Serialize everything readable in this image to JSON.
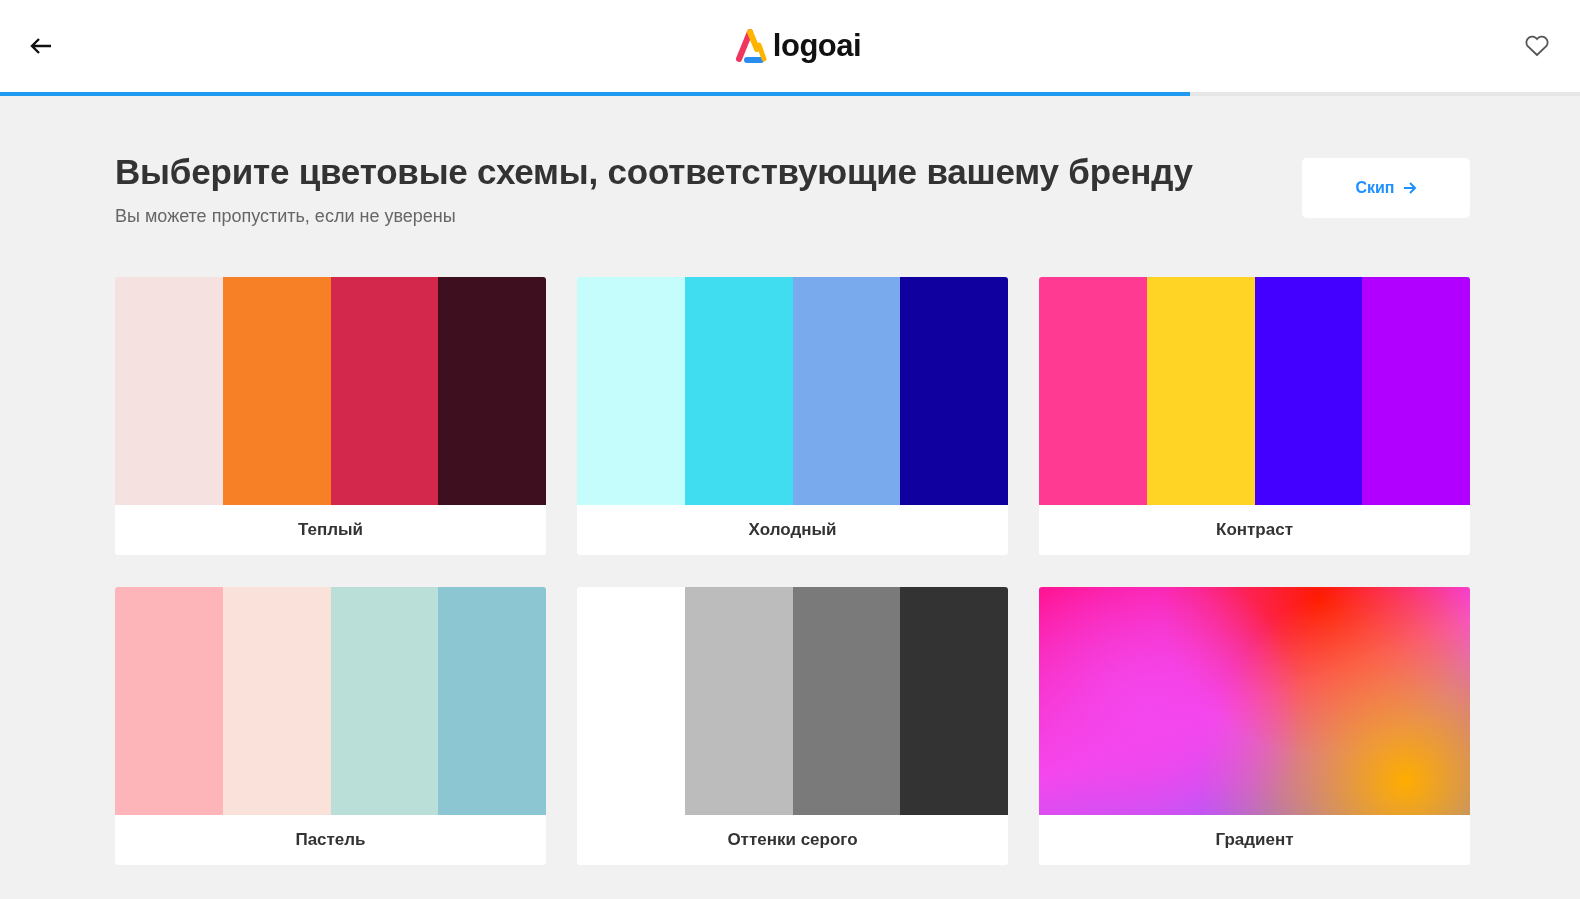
{
  "header": {
    "logo_text": "logoai",
    "progress": {
      "level": 0.753
    }
  },
  "heading": {
    "title": "Выберите цветовые схемы, соответствующие вашему бренду",
    "subtitle": "Вы можете пропустить, если не уверены",
    "skip_button": "Скип"
  },
  "schemes": [
    {
      "kind": "swatches",
      "name": "Теплый",
      "swatches": [
        {
          "color": "#f5e1e0"
        },
        {
          "color": "#f77f25"
        },
        {
          "color": "#d3284c"
        },
        {
          "color": "#3e0f1e"
        }
      ]
    },
    {
      "kind": "swatches",
      "name": "Холодный",
      "swatches": [
        {
          "color": "#c4fdfb"
        },
        {
          "color": "#40dcf0"
        },
        {
          "color": "#79aaee"
        },
        {
          "color": "#1000a0"
        }
      ]
    },
    {
      "kind": "swatches",
      "name": "Контраст",
      "swatches": [
        {
          "color": "#ff3a92"
        },
        {
          "color": "#ffd424"
        },
        {
          "color": "#4400ff"
        },
        {
          "color": "#b100ff"
        }
      ]
    },
    {
      "kind": "swatches",
      "name": "Пастель",
      "swatches": [
        {
          "color": "#feb5b9"
        },
        {
          "color": "#fae2da"
        },
        {
          "color": "#badfd8"
        },
        {
          "color": "#8bc6d2"
        }
      ]
    },
    {
      "kind": "swatches",
      "name": "Оттенки серого",
      "swatches": [
        {
          "color": "#ffffff"
        },
        {
          "color": "#bcbcbc"
        },
        {
          "color": "#7a7a7a"
        },
        {
          "color": "#333333"
        }
      ]
    },
    {
      "kind": "gradient",
      "name": "Градиент"
    }
  ]
}
